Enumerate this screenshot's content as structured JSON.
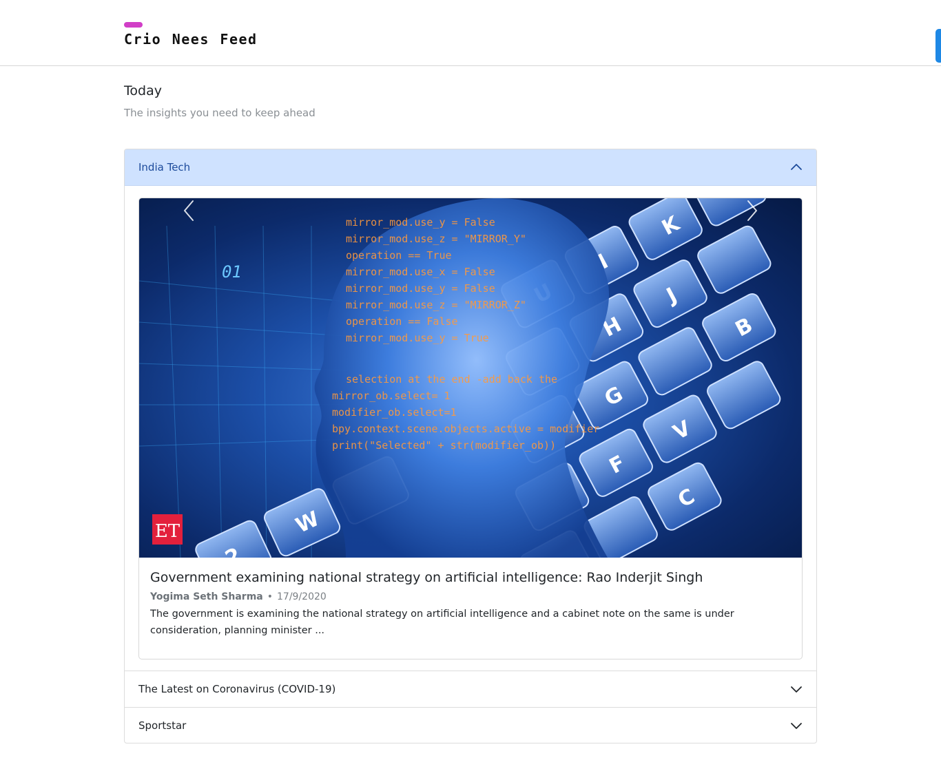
{
  "header": {
    "brand": "Crio Nees Feed",
    "accent_color": "#d13fc7"
  },
  "intro": {
    "title": "Today",
    "subtitle": "The insights you need to keep ahead"
  },
  "accordion": {
    "sections": [
      {
        "label": "India Tech",
        "expanded": true,
        "article": {
          "image_description": "Blue digital illustration of a human head profile with code lines and a laptop keyboard",
          "source_logo": "ET",
          "title": "Government examining national strategy on artificial intelligence: Rao Inderjit Singh",
          "author": "Yogima Seth Sharma",
          "separator": "•",
          "date": "17/9/2020",
          "description": "The government is examining the national strategy on artificial intelligence and a cabinet note on the same is under consideration, planning minister ..."
        }
      },
      {
        "label": "The Latest on Coronavirus (COVID-19)",
        "expanded": false
      },
      {
        "label": "Sportstar",
        "expanded": false
      }
    ]
  },
  "colors": {
    "active_header_bg": "#cfe2ff",
    "active_header_text": "#1c4a9b",
    "edge_tab": "#1e88e5"
  },
  "icons": {
    "expanded": "chevron-up-icon",
    "collapsed": "chevron-down-icon",
    "carousel_prev": "chevron-left-icon",
    "carousel_next": "chevron-right-icon"
  }
}
